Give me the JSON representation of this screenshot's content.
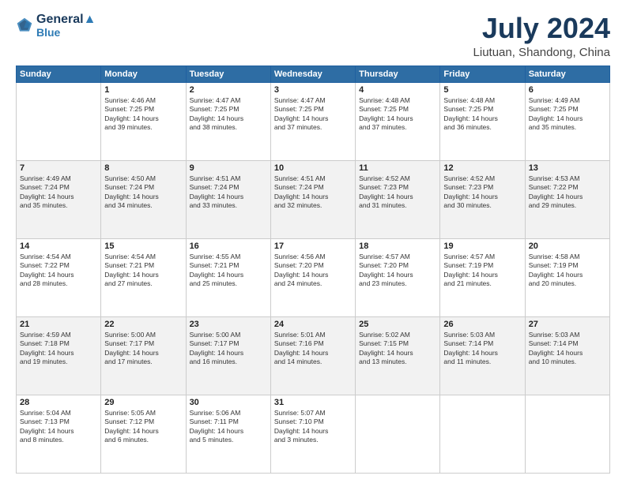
{
  "logo": {
    "line1": "General",
    "line2": "Blue"
  },
  "title": "July 2024",
  "subtitle": "Liutuan, Shandong, China",
  "days_header": [
    "Sunday",
    "Monday",
    "Tuesday",
    "Wednesday",
    "Thursday",
    "Friday",
    "Saturday"
  ],
  "weeks": [
    [
      {
        "num": "",
        "info": ""
      },
      {
        "num": "1",
        "info": "Sunrise: 4:46 AM\nSunset: 7:25 PM\nDaylight: 14 hours\nand 39 minutes."
      },
      {
        "num": "2",
        "info": "Sunrise: 4:47 AM\nSunset: 7:25 PM\nDaylight: 14 hours\nand 38 minutes."
      },
      {
        "num": "3",
        "info": "Sunrise: 4:47 AM\nSunset: 7:25 PM\nDaylight: 14 hours\nand 37 minutes."
      },
      {
        "num": "4",
        "info": "Sunrise: 4:48 AM\nSunset: 7:25 PM\nDaylight: 14 hours\nand 37 minutes."
      },
      {
        "num": "5",
        "info": "Sunrise: 4:48 AM\nSunset: 7:25 PM\nDaylight: 14 hours\nand 36 minutes."
      },
      {
        "num": "6",
        "info": "Sunrise: 4:49 AM\nSunset: 7:25 PM\nDaylight: 14 hours\nand 35 minutes."
      }
    ],
    [
      {
        "num": "7",
        "info": "Sunrise: 4:49 AM\nSunset: 7:24 PM\nDaylight: 14 hours\nand 35 minutes."
      },
      {
        "num": "8",
        "info": "Sunrise: 4:50 AM\nSunset: 7:24 PM\nDaylight: 14 hours\nand 34 minutes."
      },
      {
        "num": "9",
        "info": "Sunrise: 4:51 AM\nSunset: 7:24 PM\nDaylight: 14 hours\nand 33 minutes."
      },
      {
        "num": "10",
        "info": "Sunrise: 4:51 AM\nSunset: 7:24 PM\nDaylight: 14 hours\nand 32 minutes."
      },
      {
        "num": "11",
        "info": "Sunrise: 4:52 AM\nSunset: 7:23 PM\nDaylight: 14 hours\nand 31 minutes."
      },
      {
        "num": "12",
        "info": "Sunrise: 4:52 AM\nSunset: 7:23 PM\nDaylight: 14 hours\nand 30 minutes."
      },
      {
        "num": "13",
        "info": "Sunrise: 4:53 AM\nSunset: 7:22 PM\nDaylight: 14 hours\nand 29 minutes."
      }
    ],
    [
      {
        "num": "14",
        "info": "Sunrise: 4:54 AM\nSunset: 7:22 PM\nDaylight: 14 hours\nand 28 minutes."
      },
      {
        "num": "15",
        "info": "Sunrise: 4:54 AM\nSunset: 7:21 PM\nDaylight: 14 hours\nand 27 minutes."
      },
      {
        "num": "16",
        "info": "Sunrise: 4:55 AM\nSunset: 7:21 PM\nDaylight: 14 hours\nand 25 minutes."
      },
      {
        "num": "17",
        "info": "Sunrise: 4:56 AM\nSunset: 7:20 PM\nDaylight: 14 hours\nand 24 minutes."
      },
      {
        "num": "18",
        "info": "Sunrise: 4:57 AM\nSunset: 7:20 PM\nDaylight: 14 hours\nand 23 minutes."
      },
      {
        "num": "19",
        "info": "Sunrise: 4:57 AM\nSunset: 7:19 PM\nDaylight: 14 hours\nand 21 minutes."
      },
      {
        "num": "20",
        "info": "Sunrise: 4:58 AM\nSunset: 7:19 PM\nDaylight: 14 hours\nand 20 minutes."
      }
    ],
    [
      {
        "num": "21",
        "info": "Sunrise: 4:59 AM\nSunset: 7:18 PM\nDaylight: 14 hours\nand 19 minutes."
      },
      {
        "num": "22",
        "info": "Sunrise: 5:00 AM\nSunset: 7:17 PM\nDaylight: 14 hours\nand 17 minutes."
      },
      {
        "num": "23",
        "info": "Sunrise: 5:00 AM\nSunset: 7:17 PM\nDaylight: 14 hours\nand 16 minutes."
      },
      {
        "num": "24",
        "info": "Sunrise: 5:01 AM\nSunset: 7:16 PM\nDaylight: 14 hours\nand 14 minutes."
      },
      {
        "num": "25",
        "info": "Sunrise: 5:02 AM\nSunset: 7:15 PM\nDaylight: 14 hours\nand 13 minutes."
      },
      {
        "num": "26",
        "info": "Sunrise: 5:03 AM\nSunset: 7:14 PM\nDaylight: 14 hours\nand 11 minutes."
      },
      {
        "num": "27",
        "info": "Sunrise: 5:03 AM\nSunset: 7:14 PM\nDaylight: 14 hours\nand 10 minutes."
      }
    ],
    [
      {
        "num": "28",
        "info": "Sunrise: 5:04 AM\nSunset: 7:13 PM\nDaylight: 14 hours\nand 8 minutes."
      },
      {
        "num": "29",
        "info": "Sunrise: 5:05 AM\nSunset: 7:12 PM\nDaylight: 14 hours\nand 6 minutes."
      },
      {
        "num": "30",
        "info": "Sunrise: 5:06 AM\nSunset: 7:11 PM\nDaylight: 14 hours\nand 5 minutes."
      },
      {
        "num": "31",
        "info": "Sunrise: 5:07 AM\nSunset: 7:10 PM\nDaylight: 14 hours\nand 3 minutes."
      },
      {
        "num": "",
        "info": ""
      },
      {
        "num": "",
        "info": ""
      },
      {
        "num": "",
        "info": ""
      }
    ]
  ]
}
